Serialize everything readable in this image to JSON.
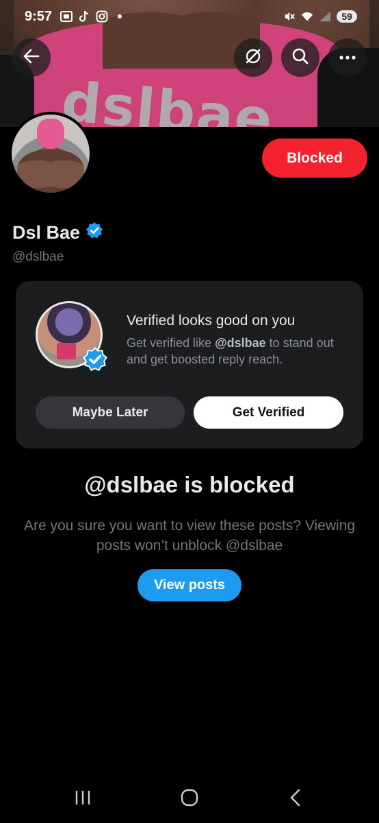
{
  "status_bar": {
    "time": "9:57",
    "battery": "59",
    "icons_left": [
      "screenshot-icon",
      "tiktok-icon",
      "instagram-icon",
      "dot-icon"
    ],
    "icons_right": [
      "mute-icon",
      "wifi-icon",
      "signal-icon"
    ]
  },
  "banner": {
    "shirt_text": "dslbae"
  },
  "toolbar": {
    "back_icon": "back-arrow-icon",
    "grok_icon": "grok-icon",
    "search_icon": "search-icon",
    "more_icon": "more-icon"
  },
  "profile": {
    "display_name": "Dsl Bae",
    "handle": "@dslbae",
    "verified": true,
    "blocked_label": "Blocked",
    "blocked_color": "#f4212e"
  },
  "verified_card": {
    "title": "Verified looks good on you",
    "desc_before": "Get verified like ",
    "desc_handle": "@dslbae",
    "desc_after": " to stand out and get boosted reply reach.",
    "maybe_later_label": "Maybe Later",
    "get_verified_label": "Get Verified"
  },
  "blocked_notice": {
    "title": "@dslbae is blocked",
    "description": "Are you sure you want to view these posts? Viewing posts won’t unblock @dslbae",
    "view_posts_label": "View posts",
    "accent_color": "#1d9bf0"
  },
  "nav_bar": {
    "recents_icon": "recents-icon",
    "home_icon": "home-icon",
    "back_icon": "back-icon"
  }
}
